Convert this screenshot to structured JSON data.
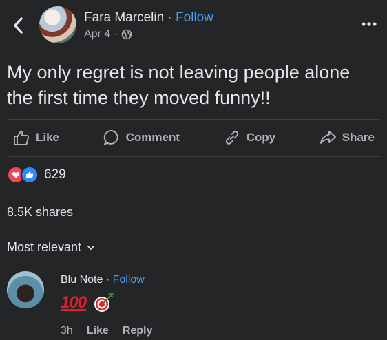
{
  "post": {
    "author": "Fara Marcelin",
    "separator": "·",
    "follow_label": "Follow",
    "date": "Apr 4",
    "meta_separator": "·",
    "privacy_icon": "globe-icon",
    "text": "My only regret is not leaving people alone the first time they moved funny!!"
  },
  "actions": [
    {
      "label": "Like",
      "icon": "thumbs-up-icon"
    },
    {
      "label": "Comment",
      "icon": "comment-icon"
    },
    {
      "label": "Copy",
      "icon": "link-icon"
    },
    {
      "label": "Share",
      "icon": "share-arrow-icon"
    }
  ],
  "reactions": {
    "types": [
      "love",
      "like"
    ],
    "count": "629"
  },
  "shares": "8.5K shares",
  "comments": {
    "sort_label": "Most relevant",
    "items": [
      {
        "author": "Blu Note",
        "separator": "·",
        "follow_label": "Follow",
        "content_emoji": [
          "hundred-points-emoji",
          "direct-hit-emoji"
        ],
        "hundred_text": "100",
        "time": "3h",
        "like_label": "Like",
        "reply_label": "Reply"
      }
    ]
  },
  "colors": {
    "background": "#242526",
    "text": "#e4e6eb",
    "secondary": "#b0b3b8",
    "link": "#4b9cf5",
    "love": "#f0465c",
    "like": "#2e89ff"
  }
}
